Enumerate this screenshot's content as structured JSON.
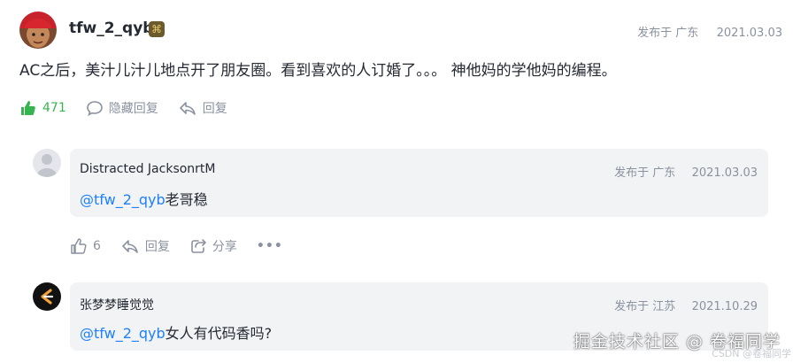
{
  "post": {
    "username": "tfw_2_qyb",
    "badge_glyph": "⌘",
    "location": "发布于 广东",
    "date": "2021.03.03",
    "text": "AC之后，美汁儿汁儿地点开了朋友圈。看到喜欢的人订婚了。。。 神他妈的学他妈的编程。",
    "likes": "471",
    "hide_reply_label": "隐藏回复",
    "reply_label": "回复"
  },
  "replies": [
    {
      "name": "Distracted JacksonrtM",
      "location": "发布于 广东",
      "date": "2021.03.03",
      "mention": "@tfw_2_qyb",
      "text": "老哥稳",
      "likes": "6",
      "reply_label": "回复",
      "share_label": "分享",
      "more_label": "•••"
    },
    {
      "name": "张梦梦睡觉觉",
      "location": "发布于 江苏",
      "date": "2021.10.29",
      "mention": "@tfw_2_qyb",
      "text": "女人有代码香吗?"
    }
  ],
  "watermark": "掘金技术社区 @ 卷福同学",
  "watermark_sub": "CSDN @卷福同学",
  "colors": {
    "like_green": "#36b450",
    "link_blue": "#1e80ff",
    "muted": "#8a919f",
    "bubble": "#f2f3f5"
  }
}
